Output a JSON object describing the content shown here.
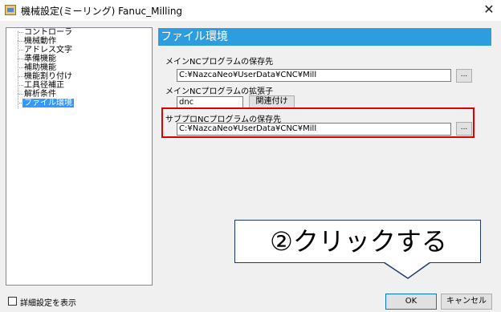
{
  "window": {
    "title": "機械設定(ミーリング) Fanuc_Milling",
    "close_symbol": "✕",
    "app_icon": "app-window-icon"
  },
  "tree": {
    "items": [
      {
        "label": "コントローラ",
        "selected": false
      },
      {
        "label": "機械動作",
        "selected": false
      },
      {
        "label": "アドレス文字",
        "selected": false
      },
      {
        "label": "準備機能",
        "selected": false
      },
      {
        "label": "補助機能",
        "selected": false
      },
      {
        "label": "機能割り付け",
        "selected": false
      },
      {
        "label": "工具径補正",
        "selected": false
      },
      {
        "label": "解析条件",
        "selected": false
      },
      {
        "label": "ファイル環境",
        "selected": true
      }
    ]
  },
  "panel": {
    "header": "ファイル環境",
    "main_program_dir_label": "メインNCプログラムの保存先",
    "main_program_dir_value": "C:¥NazcaNeo¥UserData¥CNC¥Mill",
    "browse_label": "...",
    "main_ext_label": "メインNCプログラムの拡張子",
    "main_ext_value": "dnc",
    "associate_label": "関連付け",
    "sub_program_dir_label": "サブプロNCプログラムの保存先",
    "sub_program_dir_value": "C:¥NazcaNeo¥UserData¥CNC¥Mill"
  },
  "annotation": {
    "callout_text": "②クリックする",
    "highlight_color": "#e00000",
    "callout_border_color": "#1f3864"
  },
  "footer": {
    "show_details_label": "詳細設定を表示",
    "show_details_checked": false,
    "ok_label": "OK",
    "cancel_label": "キャンセル"
  },
  "colors": {
    "header_bg": "#2e9de0",
    "selection_bg": "#3399ff"
  }
}
